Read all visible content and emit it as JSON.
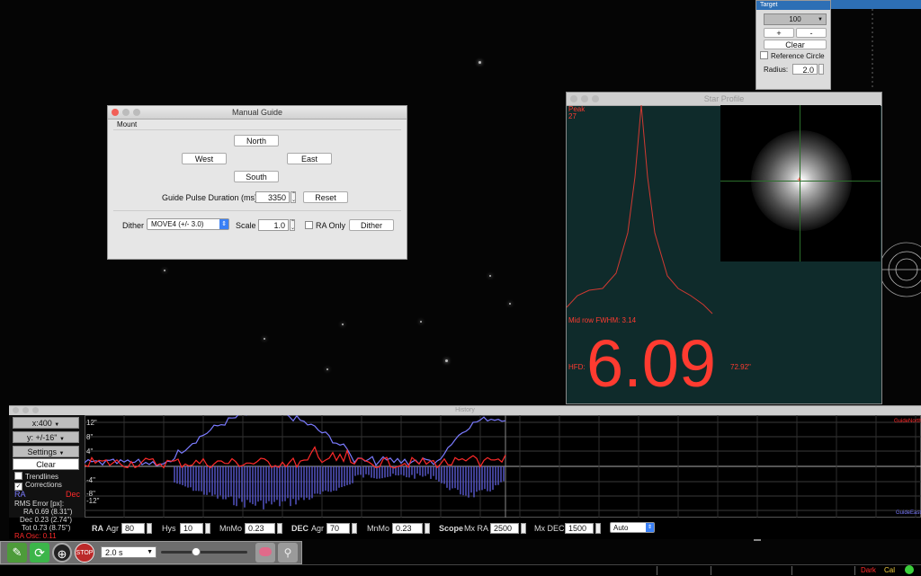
{
  "manual_guide": {
    "title": "Manual Guide",
    "section": "Mount",
    "north": "North",
    "west": "West",
    "east": "East",
    "south": "South",
    "pulse_label": "Guide Pulse Duration (ms):",
    "pulse_value": "3350",
    "reset": "Reset",
    "dither_label": "Dither",
    "dither_mode": "MOVE4 (+/- 3.0)",
    "scale_label": "Scale",
    "scale_value": "1.0",
    "ra_only": "RA Only",
    "dither_button": "Dither"
  },
  "target": {
    "title": "Target",
    "zoom": "100",
    "plus": "+",
    "minus": "-",
    "clear": "Clear",
    "reference_circle": "Reference Circle",
    "radius_label": "Radius:",
    "radius_value": "2.0"
  },
  "star_profile": {
    "title": "Star Profile",
    "peak_label": "Peak",
    "peak_value": "27",
    "fwhm": "Mid row FWHM: 3.14",
    "hfd_label": "HFD:",
    "hfd_value": "6.09",
    "arcsec": "72.92\""
  },
  "history": {
    "title": "History",
    "x_scale": "x:400",
    "y_scale": "y: +/-16\"",
    "settings": "Settings",
    "clear": "Clear",
    "trendlines": "Trendlines",
    "corrections": "Corrections",
    "ra_legend": "RA",
    "dec_legend": "Dec",
    "rms_title": "RMS Error [px]:",
    "rms_ra": "RA   0.69 (8.31\")",
    "rms_dec": "Dec   0.23 (2.74\")",
    "rms_tot": "Tot   0.73 (8.75\")",
    "ra_osc": "RA Osc: 0.11",
    "y_ticks": [
      "12\"",
      "8\"",
      "4\"",
      "-4\"",
      "-8\"",
      "-12\""
    ],
    "guide_north": "GuideNorth",
    "guide_east": "GuideEast",
    "colors": {
      "ra": "#7b7bff",
      "dec": "#ff2a2a"
    }
  },
  "controls": {
    "ra_title": "RA",
    "agr_label": "Agr",
    "ra_agr": "80",
    "hys_label": "Hys",
    "ra_hys": "10",
    "mnmo_label": "MnMo",
    "ra_mnmo": "0.23",
    "dec_title": "DEC",
    "dec_agr": "70",
    "dec_mnmo": "0.23",
    "scope_title": "Scope",
    "mxra_label": "Mx RA",
    "mxra": "2500",
    "mxdec_label": "Mx DEC",
    "mxdec": "1500",
    "mode": "Auto"
  },
  "toolbar": {
    "exposure": "2.0 s",
    "stop": "STOP",
    "exposure_fraction": 0.2
  },
  "status": {
    "dark": "Dark",
    "cal": "Cal"
  }
}
